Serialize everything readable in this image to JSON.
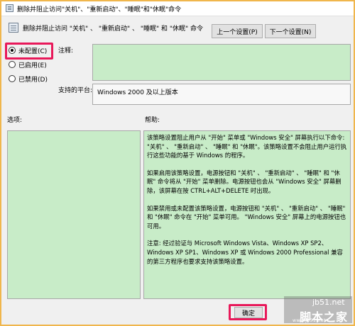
{
  "window": {
    "title": "删除并阻止访问\"关机\"、\"重新启动\"、\"睡眠\"和\"休眠\"命令"
  },
  "header": {
    "policy_title": "删除并阻止访问 \"关机\" 、 \"重新启动\" 、 \"睡眠\" 和 \"休眠\" 命令"
  },
  "buttons": {
    "prev": "上一个设置(P)",
    "next": "下一个设置(N)",
    "ok": "确定"
  },
  "options": [
    {
      "label": "未配置(C)",
      "checked": true
    },
    {
      "label": "已启用(E)",
      "checked": false
    },
    {
      "label": "已禁用(D)",
      "checked": false
    }
  ],
  "labels": {
    "comment": "注释:",
    "platform": "支持的平台:",
    "options": "选项:",
    "help": "帮助:"
  },
  "platform_value": "Windows 2000 及以上版本",
  "help_paragraphs": [
    "该策略设置阻止用户从 \"开始\" 菜单或 \"Windows 安全\" 屏幕执行以下命令: \"关机\" 、 \"重新启动\" 、 \"睡眠\" 和 \"休眠\"。该策略设置不会阻止用户运行执行这些功能的基于 Windows 的程序。",
    "如果启用该策略设置，电源按钮和 \"关机\" 、 \"重新启动\" 、 \"睡眠\" 和 \"休眠\" 命令将从 \"开始\" 菜单删除。电源按钮也会从 \"Windows 安全\" 屏幕删除，该屏幕在按 CTRL+ALT+DELETE 时出现。",
    "如果禁用或未配置该策略设置，电源按钮和 \"关机\" 、 \"重新启动\" 、 \"睡眠\" 和 \"休眠\" 命令在 \"开始\" 菜单可用。 \"Windows 安全\" 屏幕上的电源按钮也可用。",
    "注意: 经过验证与 Microsoft Windows Vista、Windows XP SP2、Windows XP SP1、Windows XP 或 Windows 2000 Professional 兼容的第三方程序也要求支持该策略设置。"
  ],
  "watermark": {
    "site": "jb51.net",
    "name": "脚本之家",
    "url": "www.jb51.net"
  },
  "colors": {
    "highlight": "#e8195a",
    "field_green": "#c8ecc8",
    "frame_orange": "#f0b64c"
  }
}
